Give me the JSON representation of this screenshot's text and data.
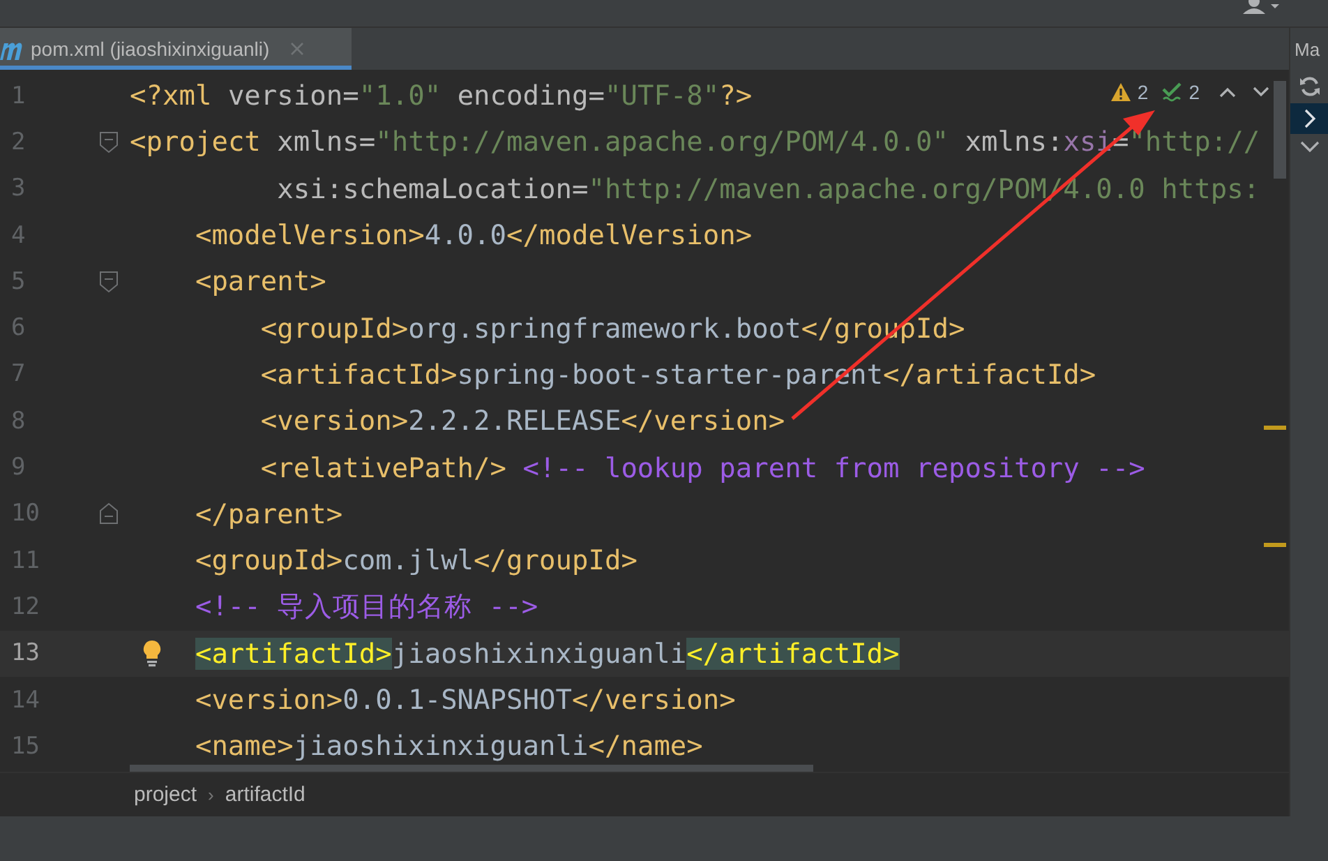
{
  "tab": {
    "title": "pom.xml (jiaoshixinxiguanli)",
    "selected": true
  },
  "inspections": {
    "warnings": "2",
    "typos": "2"
  },
  "lines": [
    {
      "number": "1",
      "current": false,
      "fold_start": false,
      "fold_end": false,
      "intention": false,
      "continuation": false,
      "tokens": [
        {
          "kind": "tag",
          "text": "<?xml",
          "matched": false
        },
        {
          "kind": "attr",
          "text": " version=",
          "matched": false
        },
        {
          "kind": "value",
          "text": "\"1.0\"",
          "matched": false
        },
        {
          "kind": "attr",
          "text": " encoding=",
          "matched": false
        },
        {
          "kind": "value",
          "text": "\"UTF-8\"",
          "matched": false
        },
        {
          "kind": "tag",
          "text": "?>",
          "matched": false
        }
      ]
    },
    {
      "number": "2",
      "current": false,
      "fold_start": true,
      "fold_end": false,
      "intention": false,
      "continuation": false,
      "tokens": [
        {
          "kind": "tag",
          "text": "<project",
          "matched": false
        },
        {
          "kind": "attr",
          "text": " xmlns=",
          "matched": false
        },
        {
          "kind": "value",
          "text": "\"http://maven.apache.org/POM/4.0.0\"",
          "matched": false
        },
        {
          "kind": "attr",
          "text": " xmlns:",
          "matched": false
        },
        {
          "kind": "ns",
          "text": "xsi",
          "matched": false
        },
        {
          "kind": "attr",
          "text": "=",
          "matched": false
        },
        {
          "kind": "value",
          "text": "\"http://",
          "matched": false
        }
      ],
      "children": [
        {
          "number": "3",
          "current": false,
          "fold_start": false,
          "fold_end": false,
          "intention": false,
          "continuation": true,
          "tokens": [
            {
              "kind": "attr",
              "text": "xsi:schemaLocation=",
              "matched": false
            },
            {
              "kind": "value",
              "text": "\"http://maven.apache.org/POM/4.0.0 https:",
              "matched": false
            }
          ]
        },
        {
          "number": "4",
          "current": false,
          "fold_start": false,
          "fold_end": false,
          "intention": false,
          "continuation": false,
          "tokens": [
            {
              "kind": "tag",
              "text": "<modelVersion>",
              "matched": false
            },
            {
              "kind": "text",
              "text": "4.0.0",
              "matched": false
            },
            {
              "kind": "tag",
              "text": "</modelVersion>",
              "matched": false
            }
          ]
        },
        {
          "number": "5",
          "current": false,
          "fold_start": true,
          "fold_end": false,
          "intention": false,
          "continuation": false,
          "tokens": [
            {
              "kind": "tag",
              "text": "<parent>",
              "matched": false
            }
          ],
          "children": [
            {
              "number": "6",
              "current": false,
              "fold_start": false,
              "fold_end": false,
              "intention": false,
              "continuation": false,
              "tokens": [
                {
                  "kind": "tag",
                  "text": "<groupId>",
                  "matched": false
                },
                {
                  "kind": "text",
                  "text": "org.springframework.boot",
                  "matched": false
                },
                {
                  "kind": "tag",
                  "text": "</groupId>",
                  "matched": false
                }
              ]
            },
            {
              "number": "7",
              "current": false,
              "fold_start": false,
              "fold_end": false,
              "intention": false,
              "continuation": false,
              "tokens": [
                {
                  "kind": "tag",
                  "text": "<artifactId>",
                  "matched": false
                },
                {
                  "kind": "text",
                  "text": "spring-boot-starter-parent",
                  "matched": false
                },
                {
                  "kind": "tag",
                  "text": "</artifactId>",
                  "matched": false
                }
              ]
            },
            {
              "number": "8",
              "current": false,
              "fold_start": false,
              "fold_end": false,
              "intention": false,
              "continuation": false,
              "tokens": [
                {
                  "kind": "tag",
                  "text": "<version>",
                  "matched": false
                },
                {
                  "kind": "text",
                  "text": "2.2.2.RELEASE",
                  "matched": false
                },
                {
                  "kind": "tag",
                  "text": "</version>",
                  "matched": false
                }
              ]
            },
            {
              "number": "9",
              "current": false,
              "fold_start": false,
              "fold_end": false,
              "intention": false,
              "continuation": false,
              "tokens": [
                {
                  "kind": "tag",
                  "text": "<relativePath/>",
                  "matched": false
                },
                {
                  "kind": "comment",
                  "text": " <!-- lookup parent from repository -->",
                  "matched": false
                }
              ]
            }
          ]
        },
        {
          "number": "10",
          "current": false,
          "fold_start": false,
          "fold_end": true,
          "intention": false,
          "continuation": false,
          "tokens": [
            {
              "kind": "tag",
              "text": "</parent>",
              "matched": false
            }
          ]
        },
        {
          "number": "11",
          "current": false,
          "fold_start": false,
          "fold_end": false,
          "intention": false,
          "continuation": false,
          "tokens": [
            {
              "kind": "tag",
              "text": "<groupId>",
              "matched": false
            },
            {
              "kind": "text",
              "text": "com.jlwl",
              "matched": false
            },
            {
              "kind": "tag",
              "text": "</groupId>",
              "matched": false
            }
          ]
        },
        {
          "number": "12",
          "current": false,
          "fold_start": false,
          "fold_end": false,
          "intention": false,
          "continuation": false,
          "tokens": [
            {
              "kind": "comment",
              "text": "<!-- 导入项目的名称 -->",
              "matched": false
            }
          ]
        },
        {
          "number": "13",
          "current": true,
          "fold_start": false,
          "fold_end": false,
          "intention": true,
          "continuation": false,
          "tokens": [
            {
              "kind": "tag",
              "text": "<artifactId>",
              "matched": true
            },
            {
              "kind": "text",
              "text": "jiaoshixinxiguanli",
              "matched": false
            },
            {
              "kind": "tag",
              "text": "</artifactId>",
              "matched": true
            }
          ]
        },
        {
          "number": "14",
          "current": false,
          "fold_start": false,
          "fold_end": false,
          "intention": false,
          "continuation": false,
          "tokens": [
            {
              "kind": "tag",
              "text": "<version>",
              "matched": false
            },
            {
              "kind": "text",
              "text": "0.0.1-SNAPSHOT",
              "matched": false
            },
            {
              "kind": "tag",
              "text": "</version>",
              "matched": false
            }
          ]
        },
        {
          "number": "15",
          "current": false,
          "fold_start": false,
          "fold_end": false,
          "intention": false,
          "continuation": false,
          "tokens": [
            {
              "kind": "tag",
              "text": "<name>",
              "matched": false
            },
            {
              "kind": "text",
              "text": "jiaoshixinxiguanli",
              "matched": false
            },
            {
              "kind": "tag",
              "text": "</name>",
              "matched": false
            }
          ]
        }
      ]
    }
  ],
  "breadcrumbs": {
    "items": [
      "project",
      "artifactId"
    ],
    "separator": "›"
  },
  "side_panel": {
    "title": "Ma"
  },
  "annotation": {
    "kind": "arrow"
  }
}
